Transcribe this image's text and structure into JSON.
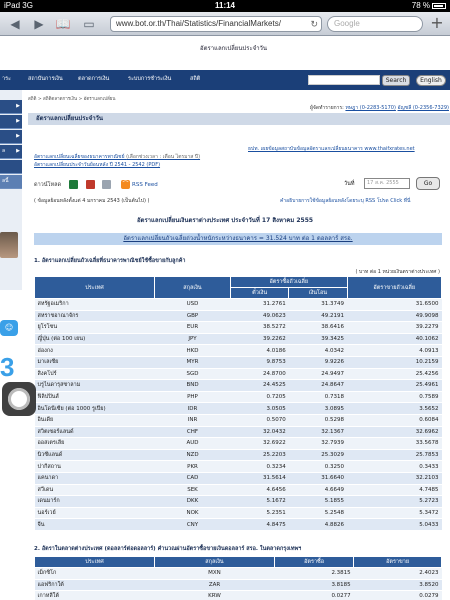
{
  "status_bar": {
    "carrier": "iPad",
    "network": "3G",
    "time": "11:14",
    "battery": "78 %"
  },
  "browser": {
    "url": "www.bot.or.th/Thai/Statistics/FinancialMarkets/",
    "search_placeholder": "Google",
    "page_tab_title": "อัตราแลกเปลี่ยนประจำวัน"
  },
  "nav": {
    "items": [
      "าระ",
      "สถาบันการเงิน",
      "ตลาดการเงิน",
      "ระบบการชำระเงิน",
      "สถิติ"
    ],
    "search_button": "Search",
    "english_button": "English"
  },
  "sidebar": {
    "items": [
      "",
      "",
      "",
      "ล",
      "",
      "",
      "",
      "",
      "ลนี้"
    ]
  },
  "breadcrumb": "สถิติ > สถิติตลาดการเงิน > อัตราแลกเปลี่ยน",
  "department": {
    "label": "ผู้จัดทำรายการ:",
    "contact1": "ทษฎา (0-2283-5170)",
    "contact2": "อัญชลี (0-2356-7329)"
  },
  "page_title": "อัตราแลกเปลี่ยนประจำวัน",
  "links": {
    "right_top": "ธปท. เผยข้อมูลสถาบันข้อมูลอัตราแลกเปลี่ยนธนาคาร www.thaifxrates.net",
    "avg_rate": "อัตราแลกเปลี่ยนเฉลี่ยของธนาคารพาณิชย์",
    "avg_rate_note": "(เลือกช่วงเวลา : เดือน ไตรมาส ปี)",
    "history": "อัตราแลกเปลี่ยนประจำวันย้อนหลัง ปี 2541 - 2542 (PDF)"
  },
  "download": {
    "label": "ดาวน์โหลด",
    "rss": "RSS Feed"
  },
  "date_picker": {
    "label": "วันที่",
    "value": "17 ส.ค. 2555",
    "go": "Go"
  },
  "note_left": "( ข้อมูลย้อนหลังตั้งแต่ 4 มกราคม 2543 (เป็นต้นไป) )",
  "note_right": "คำอธิบายการใช้ข้อมูลย้อนหลังโดยระบุ RSS โปรด Click ที่นี่",
  "rate_title": "อัตราแลกเปลี่ยนเงินตราต่างประเทศ ประจำวันที่ 17 สิงหาคม 2555",
  "interbank": "อัตราแลกเปลี่ยนถัวเฉลี่ยถ่วงน้ำหนักระหว่างธนาคาร = 31.524 บาท ต่อ 1 ดอลลาร์ สรอ.",
  "section1": {
    "title": "1. อัตราแลกเปลี่ยนถัวเฉลี่ยที่ธนาคารพาณิชย์ใช้ซื้อขายกับลูกค้า",
    "unit": "( บาท ต่อ 1 หน่วยเงินตราต่างประเทศ )",
    "headers": {
      "country": "ประเทศ",
      "currency": "สกุลเงิน",
      "buying": "อัตราซื้อถัวเฉลี่ย",
      "sight": "ตั๋วเงิน",
      "tt": "เงินโอน",
      "selling": "อัตราขายถัวเฉลี่ย"
    },
    "rows": [
      [
        "สหรัฐอเมริกา",
        "USD",
        "31.2761",
        "31.3749",
        "31.6500"
      ],
      [
        "สหราชอาณาจักร",
        "GBP",
        "49.0623",
        "49.2191",
        "49.9098"
      ],
      [
        "ยูโรโซน",
        "EUR",
        "38.5272",
        "38.6416",
        "39.2279"
      ],
      [
        "ญี่ปุ่น (ต่อ 100 เยน)",
        "JPY",
        "39.2262",
        "39.3425",
        "40.1062"
      ],
      [
        "ฮ่องกง",
        "HKD",
        "4.0186",
        "4.0342",
        "4.0913"
      ],
      [
        "มาเลเซีย",
        "MYR",
        "9.8753",
        "9.9226",
        "10.2159"
      ],
      [
        "สิงคโปร์",
        "SGD",
        "24.8700",
        "24.9497",
        "25.4256"
      ],
      [
        "บรูไนดารุสซาลาม",
        "BND",
        "24.4525",
        "24.8647",
        "25.4961"
      ],
      [
        "ฟิลิปปินส์",
        "PHP",
        "0.7205",
        "0.7318",
        "0.7589"
      ],
      [
        "อินโดนีเซีย (ต่อ 1000 รูเปีย)",
        "IDR",
        "3.0505",
        "3.0895",
        "3.5652"
      ],
      [
        "อินเดีย",
        "INR",
        "0.5070",
        "0.5298",
        "0.6084"
      ],
      [
        "สวิตเซอร์แลนด์",
        "CHF",
        "32.0432",
        "32.1367",
        "32.6962"
      ],
      [
        "ออสเตรเลีย",
        "AUD",
        "32.6922",
        "32.7939",
        "33.5678"
      ],
      [
        "นิวซีแลนด์",
        "NZD",
        "25.2203",
        "25.3029",
        "25.7853"
      ],
      [
        "ปากีสถาน",
        "PKR",
        "0.3234",
        "0.3250",
        "0.3433"
      ],
      [
        "แคนาดา",
        "CAD",
        "31.5614",
        "31.6640",
        "32.2103"
      ],
      [
        "สวีเดน",
        "SEK",
        "4.6456",
        "4.6649",
        "4.7485"
      ],
      [
        "เดนมาร์ก",
        "DKK",
        "5.1672",
        "5.1855",
        "5.2723"
      ],
      [
        "นอร์เวย์",
        "NOK",
        "5.2351",
        "5.2548",
        "5.3472"
      ],
      [
        "จีน",
        "CNY",
        "4.8475",
        "4.8826",
        "5.0433"
      ]
    ]
  },
  "section2": {
    "title": "2. อัตราในตลาดต่างประเทศ (ดอลลาร์ต่อดอลลาร์) คำนวณผ่านอัตราซื้อขายเงินดอลลาร์ สรอ. ในตลาดกรุงเทพฯ",
    "headers": {
      "country": "ประเทศ",
      "currency": "สกุลเงิน",
      "buying": "อัตราซื้อ",
      "selling": "อัตราขาย"
    },
    "rows": [
      [
        "เม็กซิโก",
        "MXN",
        "2.3815",
        "2.4023"
      ],
      [
        "แอฟริกาใต้",
        "ZAR",
        "3.8185",
        "3.8520"
      ],
      [
        "เกาหลีใต้",
        "KRW",
        "0.0277",
        "0.0279"
      ]
    ]
  }
}
